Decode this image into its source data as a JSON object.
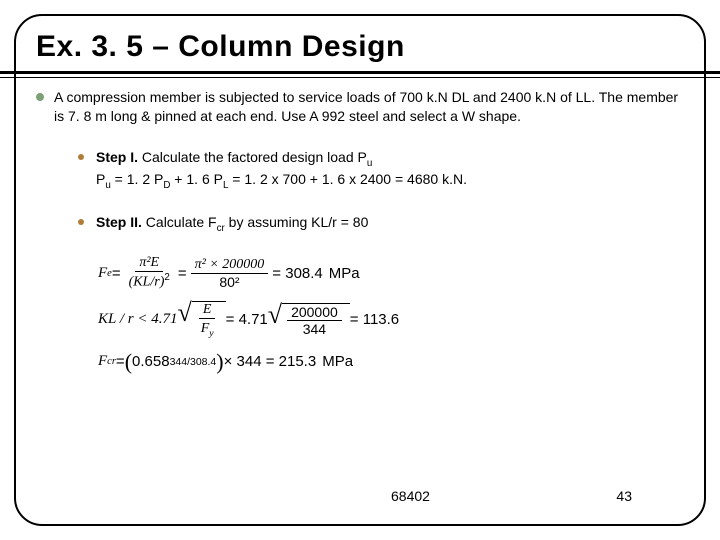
{
  "title": "Ex. 3. 5 – Column Design",
  "problem": "A compression member is subjected to service loads of 700 k.N DL and 2400 k.N of LL. The member is 7. 8 m long & pinned at each end. Use A 992 steel and select a W shape.",
  "step1": {
    "label": "Step I.",
    "text1": " Calculate the factored design load P",
    "sub1": "u",
    "line2_pre": "P",
    "line2_sub1": "u",
    "line2_mid": " = 1. 2 P",
    "line2_sub2": "D",
    "line2_mid2": " + 1. 6 P",
    "line2_sub3": "L",
    "line2_end": " = 1. 2 x 700 + 1. 6 x 2400 = 4680 k.N."
  },
  "step2": {
    "label": "Step II.",
    "text": " Calculate F",
    "sub": "cr",
    "tail": " by assuming KL/r = 80"
  },
  "eq1": {
    "lhs_sym": "F",
    "lhs_sub": "e",
    "eq": " = ",
    "num1": "π²E",
    "den1_a": "(KL/r)",
    "den1_sup": "2",
    "num2": "π² × 200000",
    "den2": "80²",
    "result": " = 308.4",
    "unit": " MPa"
  },
  "eq2": {
    "lhs": "KL / r < 4.71",
    "sq_num": "E",
    "sq_den_a": "F",
    "sq_den_sub": "y",
    "mid": " = 4.71",
    "sq2_num": "200000",
    "sq2_den": "344",
    "result": " = 113.6"
  },
  "eq3": {
    "lhs_sym": "F",
    "lhs_sub": "cr",
    "eq": " = ",
    "base": "0.658",
    "exp": "344/308.4",
    "tail": "× 344 = 215.3",
    "unit": " MPa"
  },
  "footer": {
    "code": "68402",
    "page": "43"
  }
}
